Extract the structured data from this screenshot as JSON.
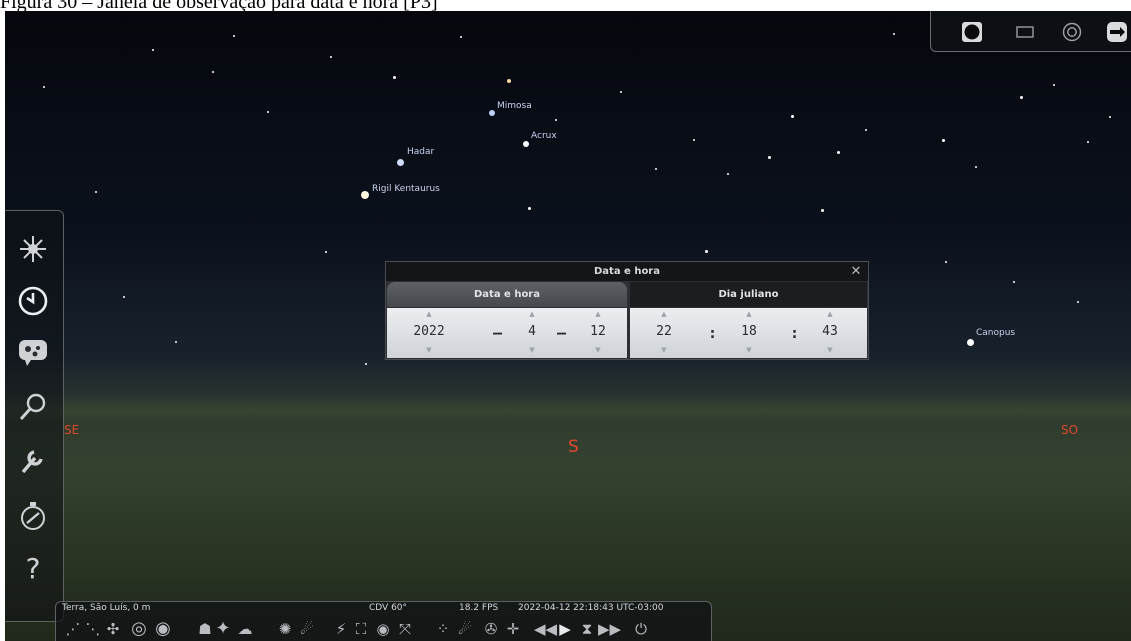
{
  "caption": "Figura 30 – Janela de observação para data e hora [P3]",
  "sky": {
    "stars": [
      {
        "name": "Mimosa",
        "label": "Mimosa"
      },
      {
        "name": "Acrux",
        "label": "Acrux"
      },
      {
        "name": "Hadar",
        "label": "Hadar"
      },
      {
        "name": "Rigil Kentaurus",
        "label": "Rigil Kentaurus"
      },
      {
        "name": "Canopus",
        "label": "Canopus"
      }
    ],
    "cardinals": {
      "se": "SE",
      "s": "S",
      "so": "SO"
    }
  },
  "dialog": {
    "title": "Data e hora",
    "close_glyph": "✕",
    "tabs": [
      {
        "label": "Data e hora",
        "active": true
      },
      {
        "label": "Dia juliano",
        "active": false
      }
    ],
    "date": {
      "year": "2022",
      "month": "4",
      "day": "12",
      "separator": "–"
    },
    "time": {
      "hour": "22",
      "minute": "18",
      "second": "43",
      "separator": ":"
    },
    "spin_up": "▲",
    "spin_down": "▼"
  },
  "status": {
    "location": "Terra, São Luís, 0 m",
    "fov": "CDV 60°",
    "fps": "18.2 FPS",
    "datetime": "2022-04-12 22:18:43 UTC-03:00"
  },
  "help_glyph": "?",
  "colors": {
    "cardinal": "#e0472a",
    "star_label": "#c7d3ee"
  }
}
